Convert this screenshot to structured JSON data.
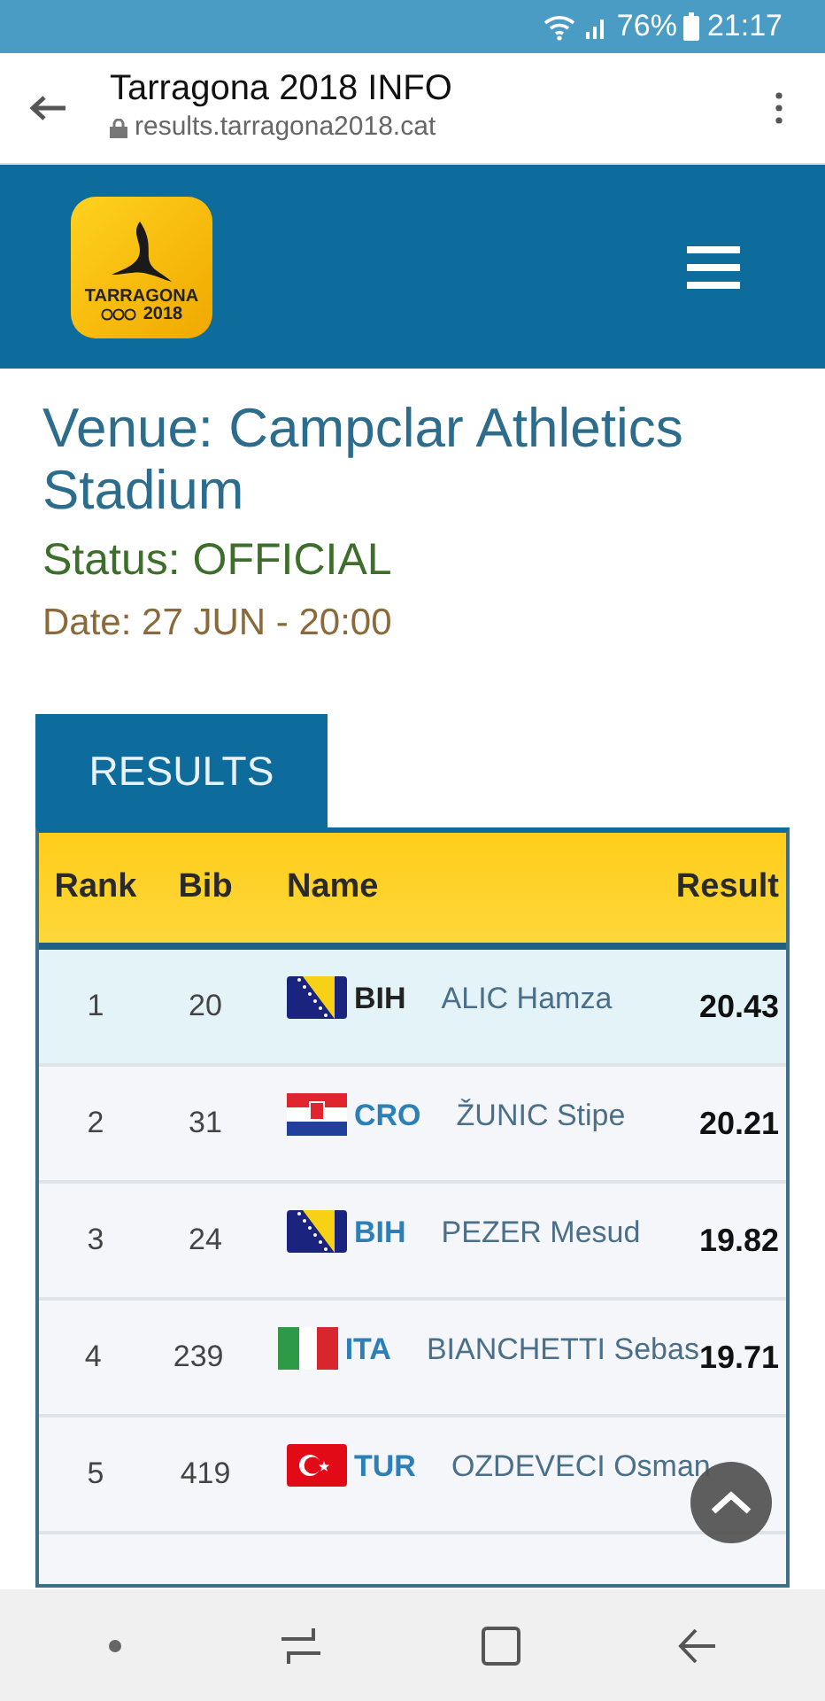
{
  "status_bar": {
    "battery": "76%",
    "time": "21:17"
  },
  "browser": {
    "title": "Tarragona 2018 INFO",
    "url": "results.tarragona2018.cat"
  },
  "site_header": {
    "logo_text": [
      "TARRAGONA",
      "2018"
    ]
  },
  "event": {
    "venue": "Venue: Campclar Athletics Stadium",
    "status": "Status: OFFICIAL",
    "date": "Date: 27 JUN - 20:00"
  },
  "tabs": [
    {
      "label": "RESULTS",
      "selected": true
    }
  ],
  "table": {
    "columns": [
      "Rank",
      "Bib",
      "Name",
      "Result"
    ],
    "rows": [
      {
        "rank": "1",
        "bib": "20",
        "kind": "bih",
        "noc": "BIH",
        "name": "ALIC Hamza",
        "result": "20.43",
        "selected": true
      },
      {
        "rank": "2",
        "bib": "31",
        "kind": "cro",
        "noc": "CRO",
        "name": "ŽUNIC Stipe",
        "result": "20.21",
        "selected": false
      },
      {
        "rank": "3",
        "bib": "24",
        "kind": "bih",
        "noc": "BIH",
        "name": "PEZER Mesud",
        "result": "19.82",
        "selected": false
      },
      {
        "rank": "4",
        "bib": "239",
        "kind": "ita",
        "noc": "ITA",
        "name": "BIANCHETTI Sebas",
        "result": "19.71",
        "selected": false
      },
      {
        "rank": "5",
        "bib": "419",
        "kind": "tur",
        "noc": "TUR",
        "name": "OZDEVECI Osman",
        "selected": false
      }
    ]
  }
}
